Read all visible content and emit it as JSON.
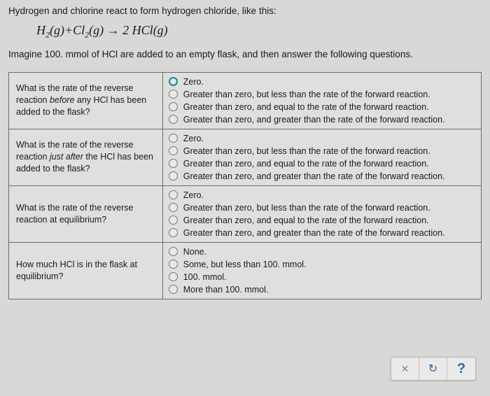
{
  "intro1": "Hydrogen and chlorine react to form hydrogen chloride, like this:",
  "equation_parts": {
    "h2": "H",
    "h2_sub": "2",
    "g1": "(g)",
    "plus": "+",
    "cl2": "Cl",
    "cl2_sub": "2",
    "g2": "(g)",
    "arrow": " → ",
    "coef": "2 ",
    "hcl": "HCl",
    "g3": "(g)"
  },
  "intro2": "Imagine 100. mmol of HCl are added to an empty flask, and then answer the following questions.",
  "rows": [
    {
      "question_parts": [
        "What is the rate of the reverse reaction ",
        "before",
        " any HCl has been added to the flask?"
      ],
      "selected": 0,
      "options": [
        "Zero.",
        "Greater than zero, but less than the rate of the forward reaction.",
        "Greater than zero, and equal to the rate of the forward reaction.",
        "Greater than zero, and greater than the rate of the forward reaction."
      ]
    },
    {
      "question_parts": [
        "What is the rate of the reverse reaction ",
        "just after",
        " the HCl has been added to the flask?"
      ],
      "selected": -1,
      "options": [
        "Zero.",
        "Greater than zero, but less than the rate of the forward reaction.",
        "Greater than zero, and equal to the rate of the forward reaction.",
        "Greater than zero, and greater than the rate of the forward reaction."
      ]
    },
    {
      "question_parts": [
        "What is the rate of the reverse reaction at equilibrium?"
      ],
      "selected": -1,
      "options": [
        "Zero.",
        "Greater than zero, but less than the rate of the forward reaction.",
        "Greater than zero, and equal to the rate of the forward reaction.",
        "Greater than zero, and greater than the rate of the forward reaction."
      ]
    },
    {
      "question_parts": [
        "How much HCl is in the flask at equilibrium?"
      ],
      "selected": -1,
      "options": [
        "None.",
        "Some, but less than 100. mmol.",
        "100. mmol.",
        "More than 100. mmol."
      ]
    }
  ],
  "buttons": {
    "close": "✕",
    "refresh": "↻",
    "help": "?"
  }
}
